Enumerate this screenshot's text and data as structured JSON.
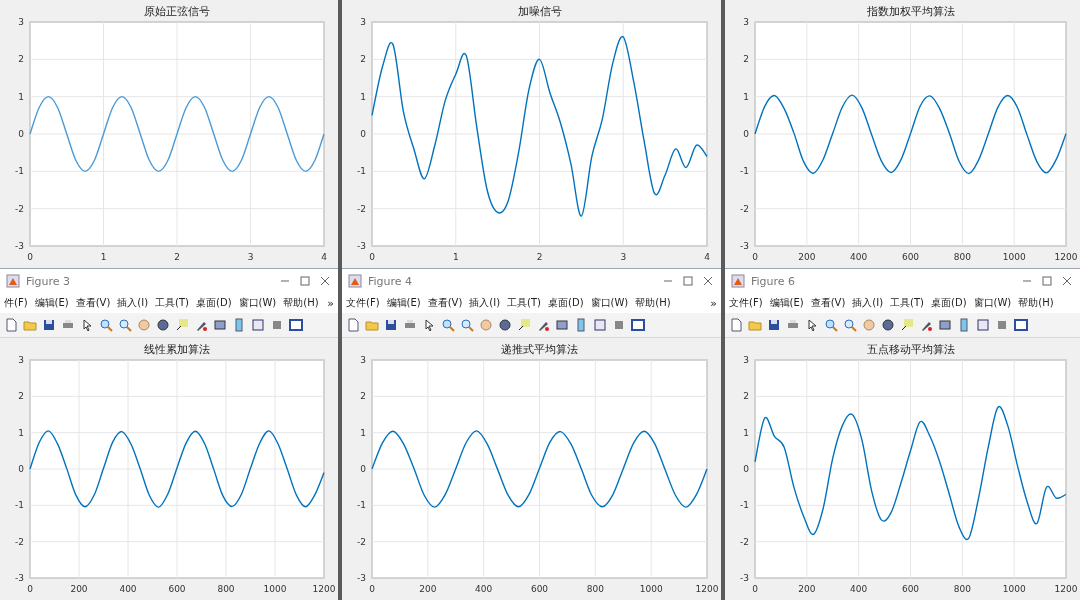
{
  "panels": [
    {
      "chart_data": {
        "type": "line",
        "grid": true,
        "title": "原始正弦信号",
        "xlim": [
          0,
          4
        ],
        "ylim": [
          -3,
          3
        ],
        "xticks": [
          0,
          1,
          2,
          3,
          4
        ],
        "yticks": [
          -3,
          -2,
          -1,
          0,
          1,
          2,
          3
        ],
        "x": [
          0,
          0.125,
          0.25,
          0.375,
          0.5,
          0.625,
          0.75,
          0.875,
          1,
          1.125,
          1.25,
          1.375,
          1.5,
          1.625,
          1.75,
          1.875,
          2,
          2.125,
          2.25,
          2.375,
          2.5,
          2.625,
          2.75,
          2.875,
          3,
          3.125,
          3.25,
          3.375,
          3.5,
          3.625,
          3.75,
          3.875,
          4
        ],
        "series": [
          {
            "color": "#4a9ad8",
            "values": [
              0,
              0.71,
              1,
              0.71,
              0,
              -0.71,
              -1,
              -0.71,
              0,
              0.71,
              1,
              0.71,
              0,
              -0.71,
              -1,
              -0.71,
              0,
              0.71,
              1,
              0.71,
              0,
              -0.71,
              -1,
              -0.71,
              0,
              0.71,
              1,
              0.71,
              0,
              -0.71,
              -1,
              -0.71,
              0
            ]
          }
        ]
      }
    },
    {
      "chart_data": {
        "type": "line",
        "grid": true,
        "title": "加噪信号",
        "xlim": [
          0,
          4
        ],
        "ylim": [
          -3,
          3
        ],
        "xticks": [
          0,
          1,
          2,
          3,
          4
        ],
        "yticks": [
          -3,
          -2,
          -1,
          0,
          1,
          2,
          3
        ],
        "x": [
          0,
          0.125,
          0.25,
          0.375,
          0.5,
          0.625,
          0.75,
          0.875,
          1,
          1.125,
          1.25,
          1.375,
          1.5,
          1.625,
          1.75,
          1.875,
          2,
          2.125,
          2.25,
          2.375,
          2.5,
          2.625,
          2.75,
          2.875,
          3,
          3.125,
          3.25,
          3.375,
          3.5,
          3.625,
          3.75,
          3.875,
          4
        ],
        "series": [
          {
            "color": "#0072bd",
            "values": [
              0.5,
              1.8,
              2.4,
              0.6,
              -0.4,
              -1.2,
              -0.3,
              0.9,
              1.6,
              2.1,
              0.2,
              -1.5,
              -2.1,
              -1.8,
              -0.5,
              1.2,
              2.0,
              1.1,
              0.3,
              -0.8,
              -2.2,
              -0.6,
              0.4,
              1.9,
              2.6,
              1.4,
              -0.2,
              -1.6,
              -1.1,
              -0.4,
              -0.9,
              -0.3,
              -0.6
            ]
          }
        ]
      }
    },
    {
      "chart_data": {
        "type": "line",
        "grid": true,
        "title": "指数加权平均算法",
        "xlim": [
          0,
          1200
        ],
        "ylim": [
          -3,
          3
        ],
        "xticks": [
          0,
          200,
          400,
          600,
          800,
          1000,
          1200
        ],
        "yticks": [
          -3,
          -2,
          -1,
          0,
          1,
          2,
          3
        ],
        "x": [
          0,
          37.5,
          75,
          112.5,
          150,
          187.5,
          225,
          262.5,
          300,
          337.5,
          375,
          412.5,
          450,
          487.5,
          525,
          562.5,
          600,
          637.5,
          675,
          712.5,
          750,
          787.5,
          825,
          862.5,
          900,
          937.5,
          975,
          1012.5,
          1050,
          1087.5,
          1125,
          1162.5,
          1200
        ],
        "series": [
          {
            "color": "#0072bd",
            "values": [
              0,
              0.74,
              1.03,
              0.68,
              0.03,
              -0.74,
              -1.05,
              -0.69,
              0.02,
              0.73,
              1.04,
              0.7,
              -0.02,
              -0.72,
              -1.03,
              -0.7,
              0.01,
              0.75,
              1.02,
              0.68,
              0.02,
              -0.73,
              -1.06,
              -0.7,
              0,
              0.72,
              1.03,
              0.71,
              -0.03,
              -0.74,
              -1.04,
              -0.68,
              0.01
            ]
          }
        ]
      }
    },
    {
      "window": {
        "title": "Figure 3",
        "menu": [
          "件(F)",
          "编辑(E)",
          "查看(V)",
          "插入(I)",
          "工具(T)",
          "桌面(D)",
          "窗口(W)",
          "帮助(H)"
        ],
        "overflow": "»"
      },
      "chart_data": {
        "type": "line",
        "grid": true,
        "title": "线性累加算法",
        "xlim": [
          0,
          1200
        ],
        "ylim": [
          -3,
          3
        ],
        "xticks": [
          0,
          200,
          400,
          600,
          800,
          1000,
          1200
        ],
        "yticks": [
          -3,
          -2,
          -1,
          0,
          1,
          2,
          3
        ],
        "x": [
          0,
          37.5,
          75,
          112.5,
          150,
          187.5,
          225,
          262.5,
          300,
          337.5,
          375,
          412.5,
          450,
          487.5,
          525,
          562.5,
          600,
          637.5,
          675,
          712.5,
          750,
          787.5,
          825,
          862.5,
          900,
          937.5,
          975,
          1012.5,
          1050,
          1087.5,
          1125,
          1162.5,
          1200
        ],
        "series": [
          {
            "color": "#0072bd",
            "values": [
              0,
              0.73,
              1.05,
              0.69,
              0.01,
              -0.72,
              -1.04,
              -0.71,
              0.02,
              0.74,
              1.03,
              0.68,
              0,
              -0.73,
              -1.05,
              -0.69,
              0.03,
              0.72,
              1.04,
              0.7,
              -0.01,
              -0.74,
              -1.03,
              -0.7,
              0.02,
              0.71,
              1.05,
              0.69,
              0,
              -0.72,
              -1.04,
              -0.71,
              -0.1
            ]
          }
        ]
      }
    },
    {
      "window": {
        "title": "Figure 4",
        "menu": [
          "文件(F)",
          "编辑(E)",
          "查看(V)",
          "插入(I)",
          "工具(T)",
          "桌面(D)",
          "窗口(W)",
          "帮助(H)"
        ],
        "overflow": "»"
      },
      "chart_data": {
        "type": "line",
        "grid": true,
        "title": "递推式平均算法",
        "xlim": [
          0,
          1200
        ],
        "ylim": [
          -3,
          3
        ],
        "xticks": [
          0,
          200,
          400,
          600,
          800,
          1000,
          1200
        ],
        "yticks": [
          -3,
          -2,
          -1,
          0,
          1,
          2,
          3
        ],
        "x": [
          0,
          37.5,
          75,
          112.5,
          150,
          187.5,
          225,
          262.5,
          300,
          337.5,
          375,
          412.5,
          450,
          487.5,
          525,
          562.5,
          600,
          637.5,
          675,
          712.5,
          750,
          787.5,
          825,
          862.5,
          900,
          937.5,
          975,
          1012.5,
          1050,
          1087.5,
          1125,
          1162.5,
          1200
        ],
        "series": [
          {
            "color": "#0072bd",
            "values": [
              0,
              0.72,
              1.04,
              0.7,
              0.02,
              -0.73,
              -1.05,
              -0.7,
              0.01,
              0.73,
              1.05,
              0.69,
              -0.01,
              -0.72,
              -1.04,
              -0.7,
              0.02,
              0.74,
              1.03,
              0.69,
              0,
              -0.73,
              -1.04,
              -0.71,
              0.01,
              0.72,
              1.04,
              0.7,
              -0.02,
              -0.73,
              -1.05,
              -0.7,
              0
            ]
          }
        ]
      }
    },
    {
      "window": {
        "title": "Figure 6",
        "menu": [
          "文件(F)",
          "编辑(E)",
          "查看(V)",
          "插入(I)",
          "工具(T)",
          "桌面(D)",
          "窗口(W)",
          "帮助(H)"
        ]
      },
      "chart_data": {
        "type": "line",
        "grid": true,
        "title": "五点移动平均算法",
        "xlim": [
          0,
          1200
        ],
        "ylim": [
          -3,
          3
        ],
        "xticks": [
          0,
          200,
          400,
          600,
          800,
          1000,
          1200
        ],
        "yticks": [
          -3,
          -2,
          -1,
          0,
          1,
          2,
          3
        ],
        "x": [
          0,
          37.5,
          75,
          112.5,
          150,
          187.5,
          225,
          262.5,
          300,
          337.5,
          375,
          412.5,
          450,
          487.5,
          525,
          562.5,
          600,
          637.5,
          675,
          712.5,
          750,
          787.5,
          825,
          862.5,
          900,
          937.5,
          975,
          1012.5,
          1050,
          1087.5,
          1125,
          1162.5,
          1200
        ],
        "series": [
          {
            "color": "#0072bd",
            "values": [
              0.2,
              1.4,
              0.9,
              0.6,
              -0.5,
              -1.3,
              -1.8,
              -1.1,
              0.3,
              1.2,
              1.5,
              0.8,
              -0.6,
              -1.4,
              -1.2,
              -0.4,
              0.5,
              1.3,
              0.9,
              0.2,
              -0.7,
              -1.6,
              -1.9,
              -0.8,
              0.6,
              1.7,
              1.2,
              0.1,
              -0.9,
              -1.5,
              -0.5,
              -0.8,
              -0.7
            ]
          }
        ]
      }
    }
  ]
}
